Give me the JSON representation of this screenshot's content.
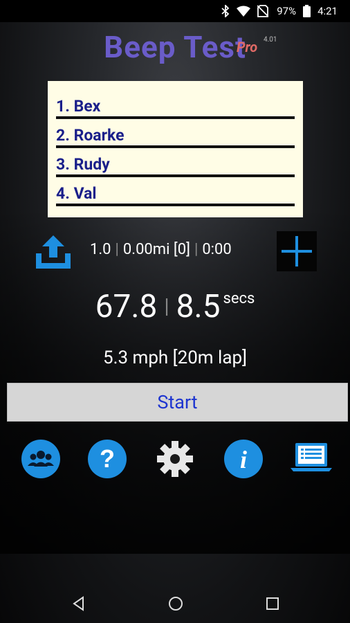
{
  "status_bar": {
    "battery": "97%",
    "time": "4:21",
    "icons": [
      "bluetooth-icon",
      "wifi-icon",
      "no-sim-icon",
      "battery-icon"
    ]
  },
  "app": {
    "title": "Beep Test",
    "edition": "Pro",
    "version": "4.01"
  },
  "players": [
    {
      "label": "1. Bex"
    },
    {
      "label": "2. Roarke"
    },
    {
      "label": "3. Rudy"
    },
    {
      "label": "4. Val"
    }
  ],
  "stats": {
    "level": "1.0",
    "distance": "0.00mi [0]",
    "elapsed": "0:00"
  },
  "timer": {
    "total": "67.8",
    "lap": "8.5",
    "unit": "secs"
  },
  "speed_text": "5.3 mph [20m lap]",
  "start_label": "Start",
  "toolbar": [
    "group-icon",
    "help-icon",
    "settings-icon",
    "info-icon",
    "results-laptop-icon"
  ],
  "colors": {
    "title": "#6a5cc9",
    "pro": "#e06a66",
    "accent_blue": "#1e8fe0",
    "player_text": "#1a1f8a",
    "list_bg": "#fffde6",
    "start_text": "#1e35d0"
  }
}
